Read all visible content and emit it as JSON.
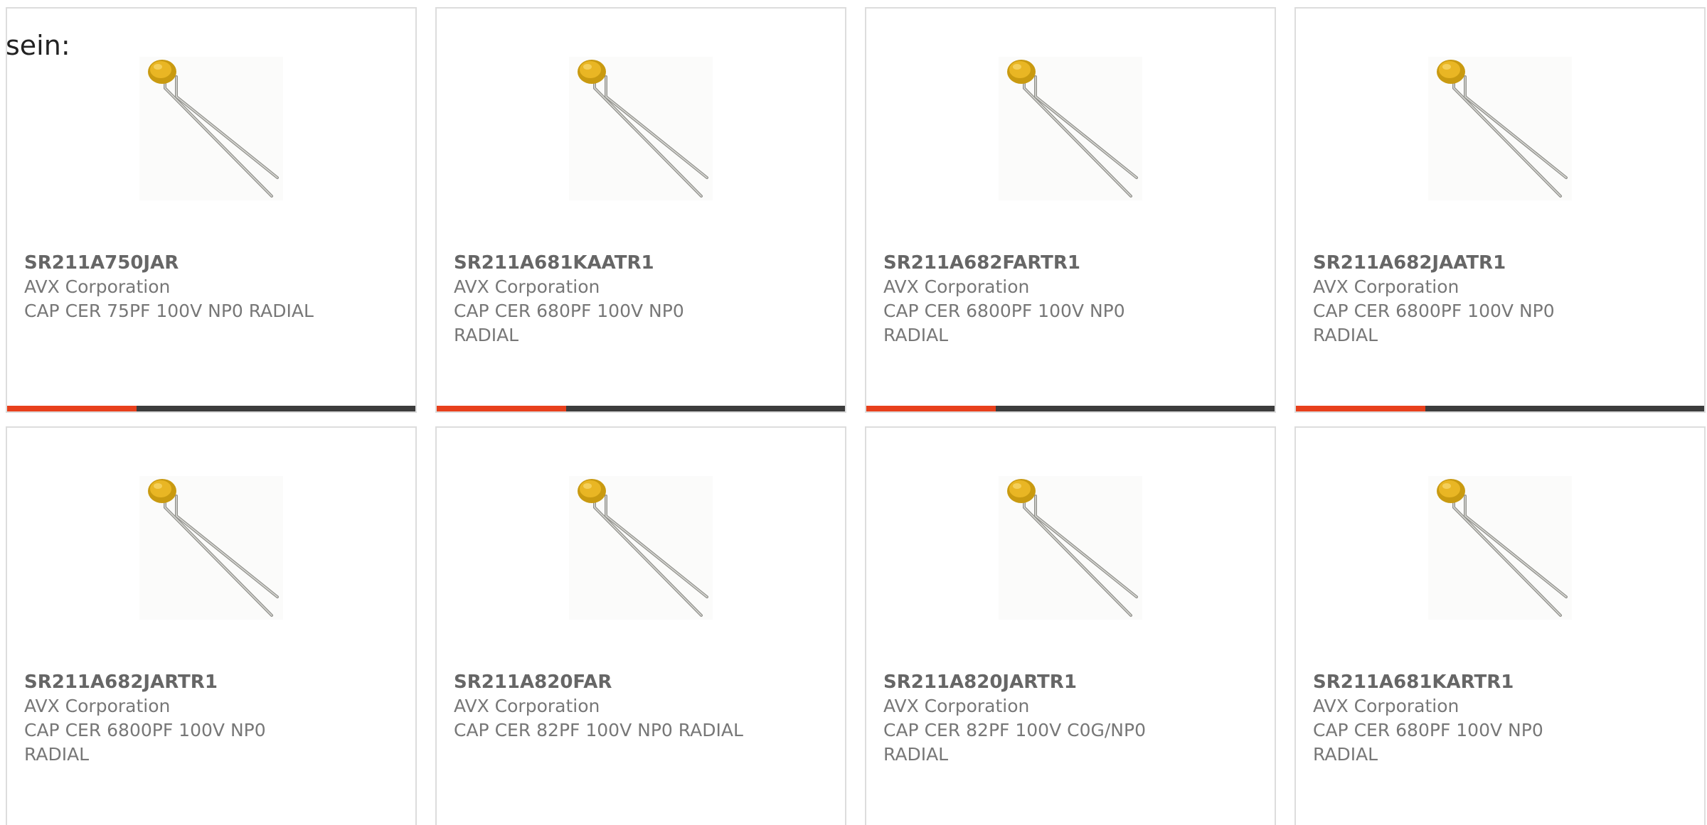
{
  "lead_text": "sein:",
  "colors": {
    "progress_accent": "#e8401c",
    "progress_track": "#3c3c3c",
    "card_border": "#dddddd",
    "part_text": "#666666",
    "body_text": "#777777"
  },
  "products": [
    {
      "part_number": "SR211A750JAR",
      "manufacturer": "AVX Corporation",
      "description": "CAP CER 75PF 100V NP0 RADIAL",
      "image": "radial-ceramic-capacitor-image"
    },
    {
      "part_number": "SR211A681KAATR1",
      "manufacturer": "AVX Corporation",
      "description": "CAP CER 680PF 100V NP0 RADIAL",
      "image": "radial-ceramic-capacitor-image"
    },
    {
      "part_number": "SR211A682FARTR1",
      "manufacturer": "AVX Corporation",
      "description": "CAP CER 6800PF 100V NP0 RADIAL",
      "image": "radial-ceramic-capacitor-image"
    },
    {
      "part_number": "SR211A682JAATR1",
      "manufacturer": "AVX Corporation",
      "description": "CAP CER 6800PF 100V NP0 RADIAL",
      "image": "radial-ceramic-capacitor-image"
    },
    {
      "part_number": "SR211A682JARTR1",
      "manufacturer": "AVX Corporation",
      "description": "CAP CER 6800PF 100V NP0 RADIAL",
      "image": "radial-ceramic-capacitor-image"
    },
    {
      "part_number": "SR211A820FAR",
      "manufacturer": "AVX Corporation",
      "description": "CAP CER 82PF 100V NP0 RADIAL",
      "image": "radial-ceramic-capacitor-image"
    },
    {
      "part_number": "SR211A820JARTR1",
      "manufacturer": "AVX Corporation",
      "description": "CAP CER 82PF 100V C0G/NP0 RADIAL",
      "image": "radial-ceramic-capacitor-image"
    },
    {
      "part_number": "SR211A681KARTR1",
      "manufacturer": "AVX Corporation",
      "description": "CAP CER 680PF 100V NP0 RADIAL",
      "image": "radial-ceramic-capacitor-image"
    }
  ]
}
